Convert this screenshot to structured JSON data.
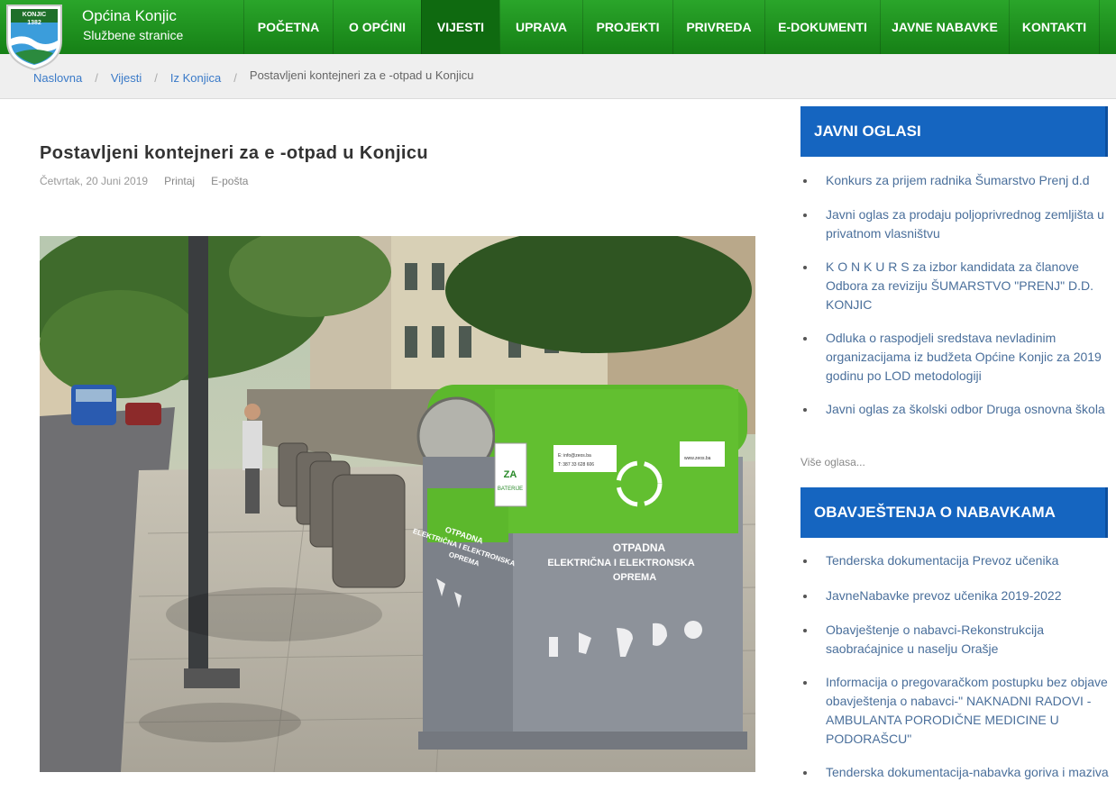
{
  "header": {
    "crest_text": "KONJIC",
    "crest_year": "1382",
    "site_name": "Općina Konjic",
    "site_sub": "Službene stranice",
    "brand_color": "#1b8a1b",
    "active_color": "#0f6a10"
  },
  "nav": [
    {
      "label": "Početna"
    },
    {
      "label": "O Općini"
    },
    {
      "label": "Vijesti"
    },
    {
      "label": "Uprava"
    },
    {
      "label": "Projekti"
    },
    {
      "label": "Privreda"
    },
    {
      "label": "e-Dokumenti"
    },
    {
      "label": "Javne nabavke"
    },
    {
      "label": "Kontakti"
    }
  ],
  "breadcrumb": {
    "items": [
      "Naslovna",
      "Vijesti",
      "Iz Konjica"
    ],
    "current": "Postavljeni kontejneri za e -otpad u Konjicu"
  },
  "article": {
    "title": "Postavljeni kontejneri za e -otpad u Konjicu",
    "date": "Četvrtak, 20 Juni 2019",
    "print_label": "Printaj",
    "email_label": "E-pošta",
    "photo_texts": {
      "sign_za": "ZA",
      "sign_baterije": "BATERIJE",
      "container_line1": "OTPADNA",
      "container_line2": "ELEKTRIČNA I ELEKTRONSKA",
      "container_line3": "OPREMA",
      "side_line1": "OTPADNA",
      "side_line2": "ELEKTRIČNA I ELEKTRONSKA",
      "side_line3": "OPREMA",
      "contact_email": "E: info@zeos.ba",
      "contact_phone": "T: 387 33 628 606",
      "url": "www.zeos.ba"
    }
  },
  "sidebar": {
    "oglasi_title": "Javni oglasi",
    "oglasi": [
      "Konkurs za prijem radnika Šumarstvo Prenj d.d",
      "Javni oglas za prodaju poljoprivrednog zemljišta u privatnom vlasništvu",
      "K O N K U R S za izbor kandidata za članove Odbora za reviziju ŠUMARSTVO \"PRENJ\" D.D. KONJIC",
      "Odluka o raspodjeli sredstava nevladinim organizacijama iz budžeta Općine Konjic za 2019 godinu po LOD metodologiji",
      "Javni oglas za školski odbor Druga osnovna škola"
    ],
    "more_label": "Više oglasa...",
    "nabavke_title": "Obavještenja o nabavkama",
    "nabavke": [
      "Tenderska dokumentacija Prevoz učenika",
      "JavneNabavke prevoz učenika 2019-2022",
      "Obavještenje o nabavci-Rekonstrukcija saobraćajnice u naselju Orašje",
      "Informacija o pregovaračkom postupku bez objave obavještenja o nabavci-\" NAKNADNI RADOVI - AMBULANTA PORODIČNE MEDICINE U PODORAŠCU\"",
      "Tenderska dokumentacija-nabavka goriva i maziva"
    ],
    "head_color": "#1565c0"
  }
}
